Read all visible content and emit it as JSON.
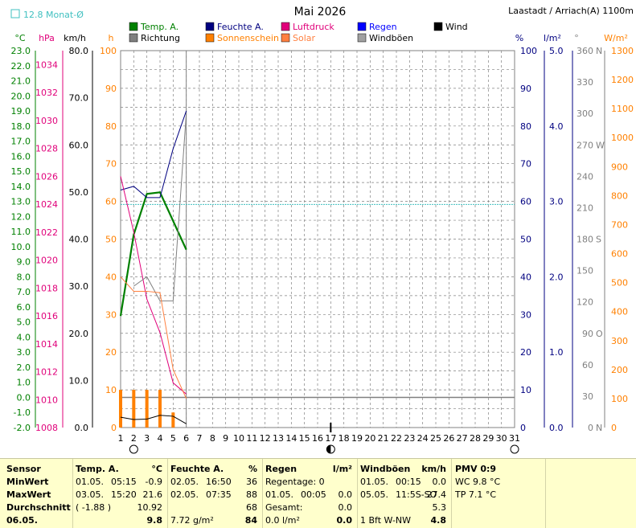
{
  "header": {
    "month_title": "Mai 2026",
    "location": "Laastadt / Arriach(A) 1100m",
    "monthly_avg_label": "12.8 Monat-Ø"
  },
  "legend": [
    {
      "label": "Temp. A.",
      "color": "#008000"
    },
    {
      "label": "Feuchte A.",
      "color": "#000080"
    },
    {
      "label": "Luftdruck",
      "color": "#e0007a"
    },
    {
      "label": "Regen",
      "color": "#0000ff"
    },
    {
      "label": "Wind",
      "color": "#000000"
    },
    {
      "label": "Richtung",
      "color": "#808080"
    },
    {
      "label": "Sonnenschein",
      "color": "#ff8000"
    },
    {
      "label": "Solar",
      "color": "#ff8040"
    },
    {
      "label": "Windböen",
      "color": "#a0a0a0"
    }
  ],
  "axis_units": {
    "temp": "°C",
    "pressure": "hPa",
    "wind": "km/h",
    "sun": "h",
    "humidity": "%",
    "rain": "l/m²",
    "direction": "°",
    "solar": "W/m²"
  },
  "chart_data": {
    "type": "line",
    "x": [
      1,
      2,
      3,
      4,
      5,
      6,
      7,
      8,
      9,
      10,
      11,
      12,
      13,
      14,
      15,
      16,
      17,
      18,
      19,
      20,
      21,
      22,
      23,
      24,
      25,
      26,
      27,
      28,
      29,
      30,
      31
    ],
    "axes": {
      "temp": {
        "label": "°C",
        "range": [
          -2.0,
          23.0
        ],
        "ticks": [
          -2.0,
          -1.0,
          0.0,
          1.0,
          2.0,
          3.0,
          4.0,
          5.0,
          6.0,
          7.0,
          8.0,
          9.0,
          10.0,
          11.0,
          12.0,
          13.0,
          14.0,
          15.0,
          16.0,
          17.0,
          18.0,
          19.0,
          20.0,
          21.0,
          22.0,
          23.0
        ]
      },
      "pressure": {
        "label": "hPa",
        "range": [
          1008,
          1035
        ],
        "ticks": [
          1008,
          1010,
          1012,
          1014,
          1016,
          1018,
          1020,
          1022,
          1024,
          1026,
          1028,
          1030,
          1032,
          1034
        ]
      },
      "wind": {
        "label": "km/h",
        "range": [
          0,
          80
        ],
        "ticks": [
          0.0,
          10.0,
          20.0,
          30.0,
          40.0,
          50.0,
          60.0,
          70.0,
          80.0
        ]
      },
      "sun": {
        "label": "h",
        "range": [
          0,
          100
        ],
        "ticks": [
          0,
          10,
          20,
          30,
          40,
          50,
          60,
          70,
          80,
          90,
          100
        ]
      },
      "humidity": {
        "label": "%",
        "range": [
          0,
          100
        ],
        "ticks": [
          0,
          10,
          20,
          30,
          40,
          50,
          60,
          70,
          80,
          90,
          100
        ]
      },
      "rain": {
        "label": "l/m²",
        "range": [
          0,
          5
        ],
        "ticks": [
          0.0,
          1.0,
          2.0,
          3.0,
          4.0,
          5.0
        ]
      },
      "direction": {
        "label": "°",
        "range": [
          0,
          360
        ],
        "ticks": [
          0,
          30,
          60,
          90,
          120,
          150,
          180,
          210,
          240,
          270,
          300,
          330,
          360
        ],
        "compass": [
          {
            "value": 0,
            "text": "N"
          },
          {
            "value": 90,
            "text": "O"
          },
          {
            "value": 180,
            "text": "S"
          },
          {
            "value": 270,
            "text": "W"
          },
          {
            "value": 360,
            "text": "N"
          }
        ]
      },
      "solar": {
        "label": "W/m²",
        "range": [
          0,
          1300
        ],
        "ticks": [
          0,
          100,
          200,
          300,
          400,
          500,
          600,
          700,
          800,
          900,
          1000,
          1100,
          1200,
          1300
        ]
      }
    },
    "series": [
      {
        "name": "Temp. A.",
        "axis": "temp",
        "color": "#008000",
        "x": [
          1,
          2,
          3,
          4,
          6
        ],
        "values": [
          5.4,
          10.8,
          13.5,
          13.6,
          9.8
        ]
      },
      {
        "name": "Feuchte A.",
        "axis": "humidity",
        "color": "#000080",
        "x": [
          1,
          2,
          3,
          4,
          5,
          6
        ],
        "values": [
          63,
          64,
          61,
          61,
          74,
          84
        ]
      },
      {
        "name": "Luftdruck",
        "axis": "pressure",
        "color": "#e0007a",
        "x": [
          1,
          2,
          3,
          4,
          5,
          6
        ],
        "values": [
          1026.0,
          1022.0,
          1017.2,
          1014.8,
          1011.2,
          1010.4
        ]
      },
      {
        "name": "Richtung",
        "axis": "direction",
        "color": "#808080",
        "x": [
          2,
          3,
          4,
          5,
          6
        ],
        "values": [
          135,
          144,
          121,
          121,
          300
        ]
      },
      {
        "name": "Solar",
        "axis": "solar",
        "color": "#ff8040",
        "x": [
          1,
          2,
          3,
          4,
          5,
          6
        ],
        "values": [
          520,
          470,
          470,
          465,
          200,
          100
        ]
      },
      {
        "name": "Wind",
        "axis": "wind",
        "color": "#000000",
        "x": [
          1,
          2,
          3,
          4,
          5,
          6
        ],
        "values": [
          2.2,
          1.7,
          1.8,
          2.6,
          2.4,
          0.8
        ]
      }
    ],
    "bars": {
      "name": "Sonnenschein",
      "axis": "sun",
      "color": "#ff8000",
      "x": [
        1,
        2,
        3,
        4,
        5
      ],
      "values": [
        10,
        10,
        10,
        10,
        4
      ]
    },
    "reference_lines": [
      {
        "name": "monthly-avg-temp",
        "axis": "temp",
        "value": 12.8,
        "color": "#40c0c0"
      },
      {
        "name": "rain-level",
        "axis": "rain",
        "value": 0.4,
        "color": "#808080"
      }
    ],
    "current_day_marker": 6,
    "moon_phases": [
      {
        "day": 2,
        "phase": "full"
      },
      {
        "day": 17,
        "phase": "new"
      },
      {
        "day": 31,
        "phase": "full"
      }
    ]
  },
  "summary": {
    "sensor": {
      "title": "Sensor",
      "rows": [
        "MinWert",
        "MaxWert",
        "Durchschnitt",
        "06.05."
      ]
    },
    "temp": {
      "title": "Temp. A.",
      "unit": "°C",
      "rows": [
        [
          "01.05.",
          "05:15",
          "-0.9"
        ],
        [
          "03.05.",
          "15:20",
          "21.6"
        ],
        [
          "( -1.88 )",
          "",
          "10.92"
        ],
        [
          "",
          "",
          "9.8"
        ]
      ]
    },
    "hum": {
      "title": "Feuchte A.",
      "unit": "%",
      "rows": [
        [
          "02.05.",
          "16:50",
          "36"
        ],
        [
          "02.05.",
          "07:35",
          "88"
        ],
        [
          "",
          "",
          "68"
        ],
        [
          "7.72 g/m²",
          "",
          "84"
        ]
      ]
    },
    "rain": {
      "title": "Regen",
      "unit": "l/m²",
      "rows": [
        [
          "Regentage: 0",
          "",
          ""
        ],
        [
          "01.05.",
          "00:05",
          "0.0"
        ],
        [
          "Gesamt:",
          "",
          "0.0"
        ],
        [
          "0.0 l/m²",
          "",
          "0.0"
        ]
      ]
    },
    "gust": {
      "title": "Windböen",
      "unit": "km/h",
      "rows": [
        [
          "01.05.",
          "00:15",
          "0.0"
        ],
        [
          "05.05.",
          "11:5S-SO",
          "27.4"
        ],
        [
          "",
          "",
          "5.3"
        ],
        [
          "1 Bft W-NW",
          "",
          "4.8"
        ]
      ]
    },
    "pmv": {
      "title": "PMV 0:9",
      "wc": "WC 9.8 °C",
      "tp": "TP 7.1 °C"
    }
  }
}
